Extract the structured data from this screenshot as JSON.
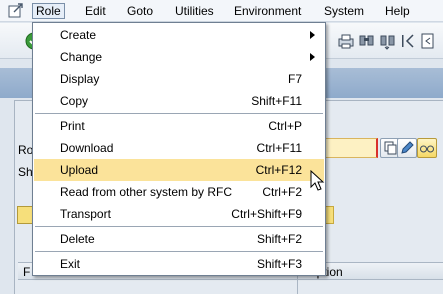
{
  "menubar": {
    "items": [
      {
        "label": "Role",
        "active": true
      },
      {
        "label": "Edit"
      },
      {
        "label": "Goto"
      },
      {
        "label": "Utilities"
      },
      {
        "label": "Environment"
      },
      {
        "label": "System"
      },
      {
        "label": "Help"
      }
    ]
  },
  "background": {
    "label_role": "Ro",
    "label_short": "Sh",
    "table_col_1": "F",
    "table_col_2": "cription"
  },
  "role_menu": {
    "items": [
      {
        "label": "Create",
        "shortcut": "",
        "submenu": true
      },
      {
        "label": "Change",
        "shortcut": "",
        "submenu": true
      },
      {
        "label": "Display",
        "shortcut": "F7"
      },
      {
        "label": "Copy",
        "shortcut": "Shift+F11"
      },
      {
        "label": "Print",
        "shortcut": "Ctrl+P"
      },
      {
        "label": "Download",
        "shortcut": "Ctrl+F11"
      },
      {
        "label": "Upload",
        "shortcut": "Ctrl+F12",
        "highlighted": true
      },
      {
        "label": "Read from other system by RFC",
        "shortcut": "Ctrl+F2"
      },
      {
        "label": "Transport",
        "shortcut": "Ctrl+Shift+F9"
      },
      {
        "label": "Delete",
        "shortcut": "Shift+F2"
      },
      {
        "label": "Exit",
        "shortcut": "Shift+F3"
      }
    ]
  },
  "colors": {
    "menu_highlight": "#fbe39a",
    "title_band": "#8eaacb",
    "required_field": "#fdf1c3"
  }
}
